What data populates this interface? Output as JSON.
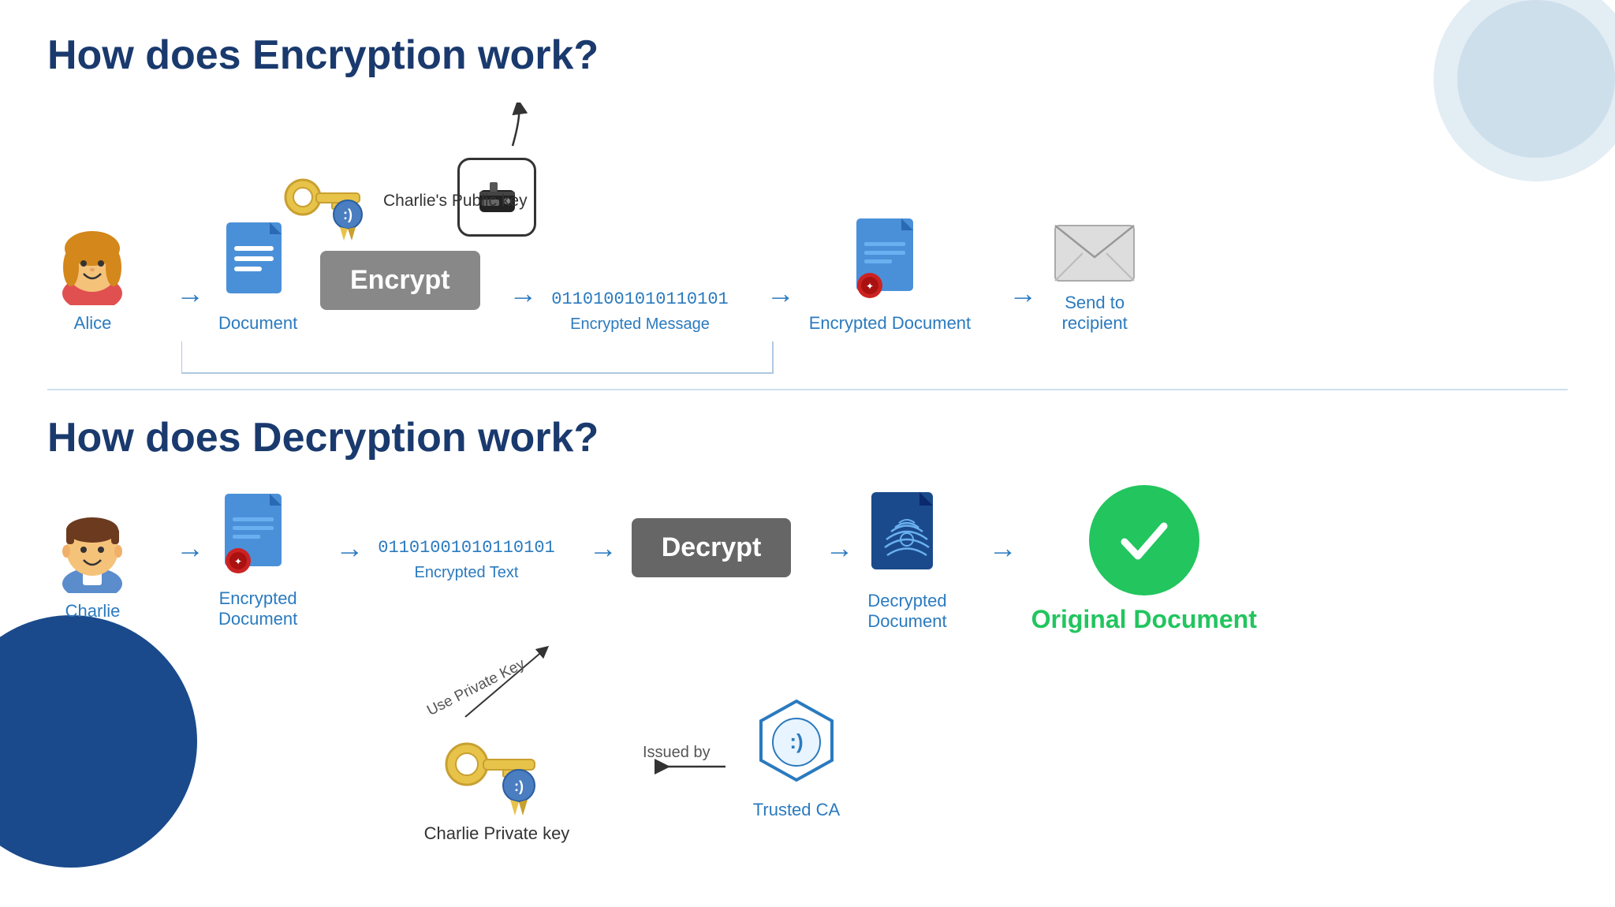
{
  "page": {
    "section1_title": "How does Encryption work?",
    "section2_title": "How does Decryption work?",
    "alice_label": "Alice",
    "document_label": "Document",
    "charlies_public_key": "Charlie's Public key",
    "encrypt_btn": "Encrypt",
    "binary_message": "01101001010110101",
    "encrypted_message_label": "Encrypted Message",
    "encrypted_doc_label": "Encrypted Document",
    "send_to_recipient_label": "Send to\nrecipient",
    "charlie_label": "Charlie",
    "encrypted_doc2_label": "Encrypted\nDocument",
    "encrypted_text_label": "Encrypted Text",
    "decrypt_btn": "Decrypt",
    "decrypted_doc_label": "Decrypted\nDocument",
    "original_document_label": "Original Document",
    "use_private_key_label": "Use Private Key",
    "charlie_private_key_label": "Charlie Private key",
    "issued_by_label": "Issued by",
    "trusted_ca_label": "Trusted CA",
    "binary2": "01101001010110101"
  },
  "colors": {
    "title": "#1a3a6e",
    "blue": "#2a7abf",
    "green": "#22c55e",
    "gray_btn": "#777",
    "dark_btn": "#555"
  }
}
